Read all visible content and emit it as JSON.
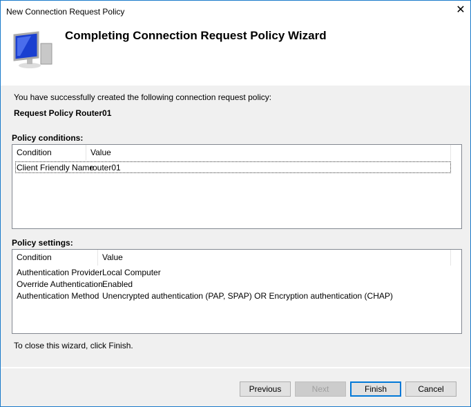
{
  "window": {
    "title": "New Connection Request Policy",
    "close_icon": "close-icon"
  },
  "header": {
    "heading": "Completing Connection Request Policy Wizard",
    "icon": "computer-monitor-icon"
  },
  "intro": "You have successfully created the following connection request policy:",
  "policy_name": "Request Policy Router01",
  "conditions": {
    "label": "Policy conditions:",
    "columns": [
      "Condition",
      "Value"
    ],
    "rows": [
      {
        "condition": "Client Friendly Name",
        "value": "router01"
      }
    ]
  },
  "settings": {
    "label": "Policy settings:",
    "columns": [
      "Condition",
      "Value"
    ],
    "rows": [
      {
        "condition": "Authentication Provider",
        "value": "Local Computer"
      },
      {
        "condition": "Override Authentication",
        "value": "Enabled"
      },
      {
        "condition": "Authentication Method",
        "value": "Unencrypted authentication (PAP, SPAP) OR Encryption authentication (CHAP)"
      }
    ]
  },
  "footer_text": "To close this wizard, click Finish.",
  "buttons": {
    "previous": "Previous",
    "next": "Next",
    "finish": "Finish",
    "cancel": "Cancel"
  }
}
